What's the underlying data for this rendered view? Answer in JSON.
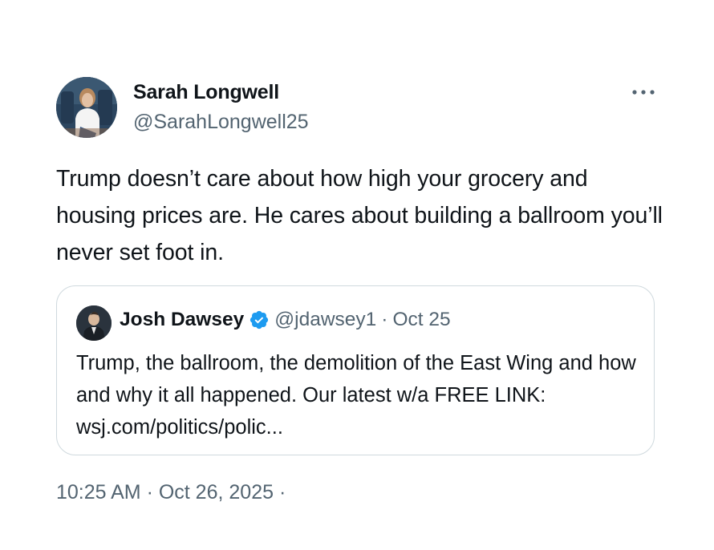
{
  "author": {
    "name": "Sarah Longwell",
    "handle": "@SarahLongwell25"
  },
  "menu": {
    "icon": "more-horizontal-icon",
    "label": "···"
  },
  "tweet": {
    "text": "Trump doesn’t care about how high your grocery and housing prices are. He cares about building a ballroom you’ll never set foot in.",
    "timestamp": "10:25 AM · Oct 26, 2025 ·"
  },
  "quote": {
    "name": "Josh Dawsey",
    "verified_icon": "verified-badge-icon",
    "handle": "@jdawsey1",
    "separator": "·",
    "date": "Oct 25",
    "text": "Trump, the ballroom, the demolition of the East Wing and how and why it all happened. Our latest w/a FREE LINK: wsj.com/politics/polic..."
  },
  "colors": {
    "text_primary": "#0f1419",
    "text_secondary": "#536471",
    "border": "#cfd9de",
    "verified_blue": "#1d9bf0"
  }
}
